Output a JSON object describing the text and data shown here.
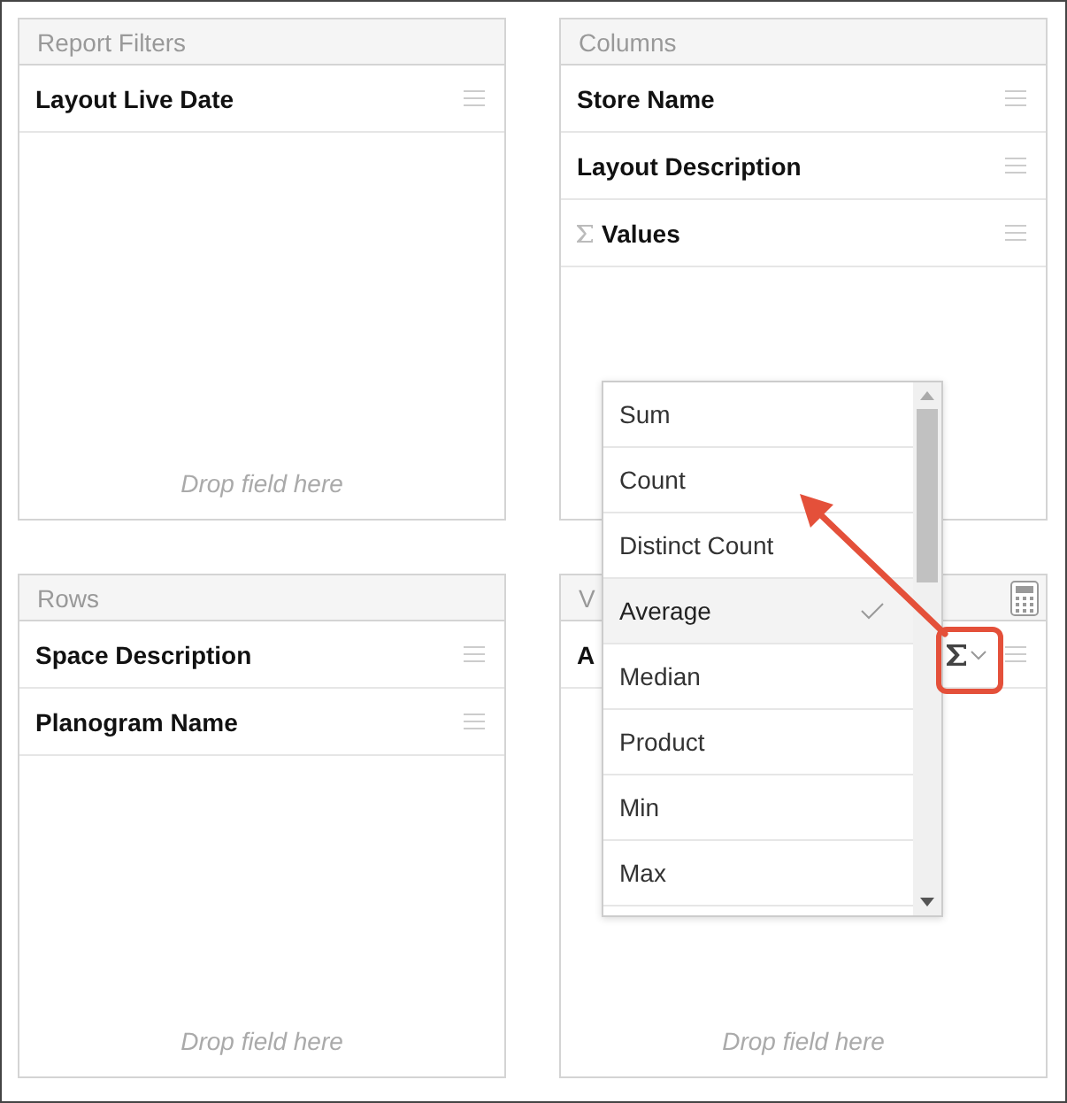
{
  "panels": [
    {
      "title": "Report Filters",
      "items": [
        {
          "label": "Layout Live Date",
          "kind": "field"
        }
      ],
      "placeholder": "Drop field here"
    },
    {
      "title": "Columns",
      "items": [
        {
          "label": "Store Name",
          "kind": "field"
        },
        {
          "label": "Layout Description",
          "kind": "field"
        },
        {
          "label": "Values",
          "kind": "values"
        }
      ]
    },
    {
      "title": "Rows",
      "items": [
        {
          "label": "Space Description",
          "kind": "field"
        },
        {
          "label": "Planogram Name",
          "kind": "field"
        }
      ],
      "placeholder": "Drop field here"
    },
    {
      "title": "V",
      "items": [
        {
          "label": "A",
          "kind": "measure"
        }
      ],
      "placeholder": "Drop field here",
      "calculator": true
    }
  ],
  "aggregation_menu": {
    "items": [
      {
        "label": "Sum",
        "selected": false
      },
      {
        "label": "Count",
        "selected": false
      },
      {
        "label": "Distinct Count",
        "selected": false
      },
      {
        "label": "Average",
        "selected": true
      },
      {
        "label": "Median",
        "selected": false
      },
      {
        "label": "Product",
        "selected": false
      },
      {
        "label": "Min",
        "selected": false
      },
      {
        "label": "Max",
        "selected": false
      }
    ]
  }
}
